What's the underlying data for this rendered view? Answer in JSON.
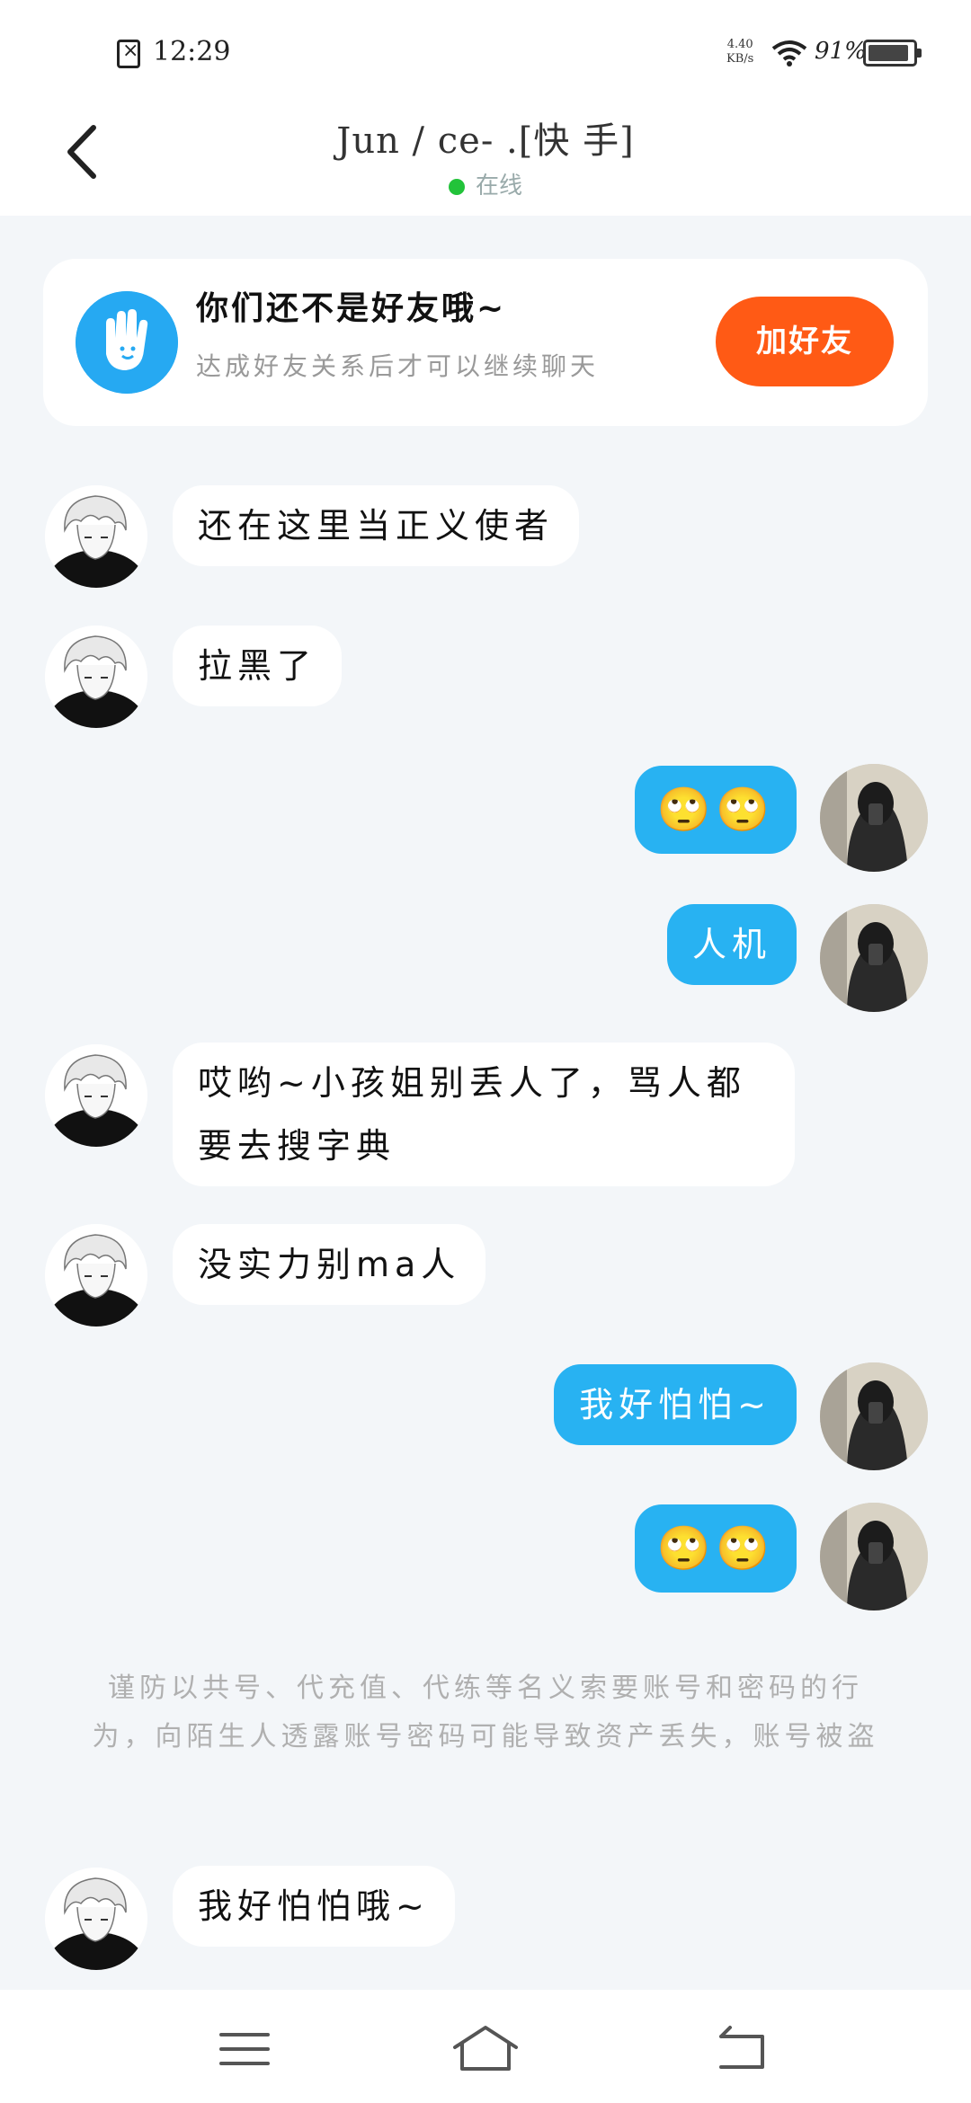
{
  "status_bar": {
    "time": "12:29",
    "net_speed": "4.40",
    "net_unit": "KB/s",
    "battery": "91%"
  },
  "header": {
    "title": "Jun / ce- .[快 手]",
    "status": "在线"
  },
  "friend_card": {
    "title": "你们还不是好友哦~",
    "subtitle": "达成好友关系后才可以继续聊天",
    "button": "加好友"
  },
  "messages": [
    {
      "side": "in",
      "text": "还在这里当正义使者"
    },
    {
      "side": "in",
      "text": "拉黑了"
    },
    {
      "side": "out",
      "text": "🙄🙄"
    },
    {
      "side": "out",
      "text": "人机"
    },
    {
      "side": "in",
      "text": "哎哟~小孩姐别丢人了，骂人都要去搜字典"
    },
    {
      "side": "in",
      "text": "没实力别ma人"
    },
    {
      "side": "out",
      "text": "我好怕怕~"
    },
    {
      "side": "out",
      "text": "🙄🙄"
    },
    {
      "side": "in",
      "text": "我好怕怕哦~"
    }
  ],
  "notice": "谨防以共号、代充值、代练等名义索要账号和密码的行为，向陌生人透露账号密码可能导致资产丢失，账号被盗"
}
